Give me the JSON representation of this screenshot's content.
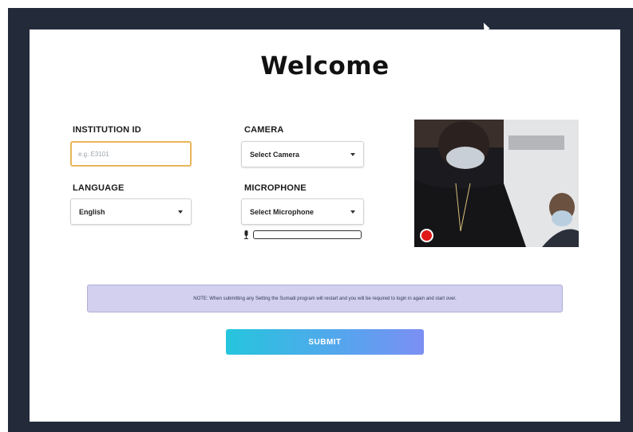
{
  "page": {
    "title": "Welcome"
  },
  "form": {
    "institution_id": {
      "label": "INSTITUTION ID",
      "value": "",
      "placeholder": "e.g. E3101"
    },
    "language": {
      "label": "LANGUAGE",
      "selected": "English"
    },
    "camera": {
      "label": "CAMERA",
      "selected": "Select Camera"
    },
    "microphone": {
      "label": "MICROPHONE",
      "selected": "Select Microphone",
      "level_percent": 0
    }
  },
  "note": {
    "text": "NOTE: When submitting any Setting the Sumadi program will restart and you will be required to login in again and start over."
  },
  "submit": {
    "label": "SUBMIT"
  },
  "icons": {
    "caret": "chevron-down-icon",
    "mic": "microphone-icon",
    "record": "record-icon",
    "cursor": "mouse-cursor-icon"
  },
  "colors": {
    "frame": "#232a3a",
    "input_border": "#e9b55a",
    "note_bg": "#d2d0ee",
    "submit_start": "#25c5dd",
    "submit_end": "#7c8ff2",
    "record": "#e01818"
  }
}
